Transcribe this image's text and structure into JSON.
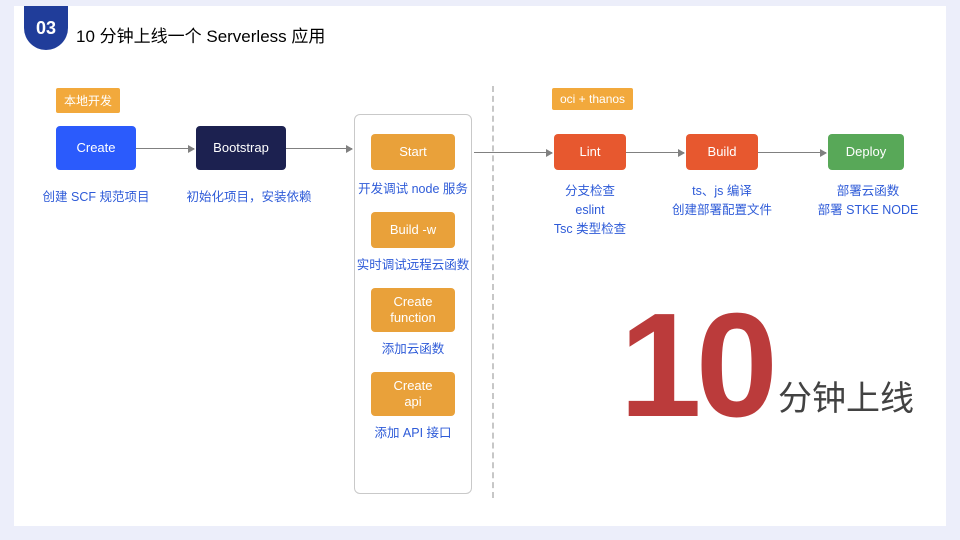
{
  "header": {
    "number": "03",
    "title": "10 分钟上线一个 Serverless 应用"
  },
  "tags": {
    "left": "本地开发",
    "right": "oci + thanos"
  },
  "nodes": {
    "create": {
      "label": "Create",
      "caption": "创建 SCF 规范项目"
    },
    "boot": {
      "label": "Bootstrap",
      "caption": "初始化项目，安装依赖"
    },
    "start": {
      "label": "Start",
      "caption": "开发调试 node 服务"
    },
    "buildw": {
      "label": "Build -w",
      "caption": "实时调试远程云函数"
    },
    "cfunc": {
      "label": "Create\nfunction",
      "caption": "添加云函数"
    },
    "capi": {
      "label": "Create\napi",
      "caption": "添加 API 接口"
    },
    "lint": {
      "label": "Lint",
      "caption": "分支检查\neslint\nTsc 类型检查"
    },
    "build": {
      "label": "Build",
      "caption": "ts、js 编译\n创建部署配置文件"
    },
    "deploy": {
      "label": "Deploy",
      "caption": "部署云函数\n部署 STKE NODE"
    }
  },
  "callout": {
    "number": "10",
    "text": "分钟上线"
  },
  "colors": {
    "badge": "#203d9a",
    "create": "#2b5bfc",
    "bootstrap": "#1c2150",
    "amber": "#e9a13a",
    "orange": "#e7582f",
    "green": "#58a858",
    "link": "#2e5bd8",
    "callout_num": "#bb3b3b"
  }
}
